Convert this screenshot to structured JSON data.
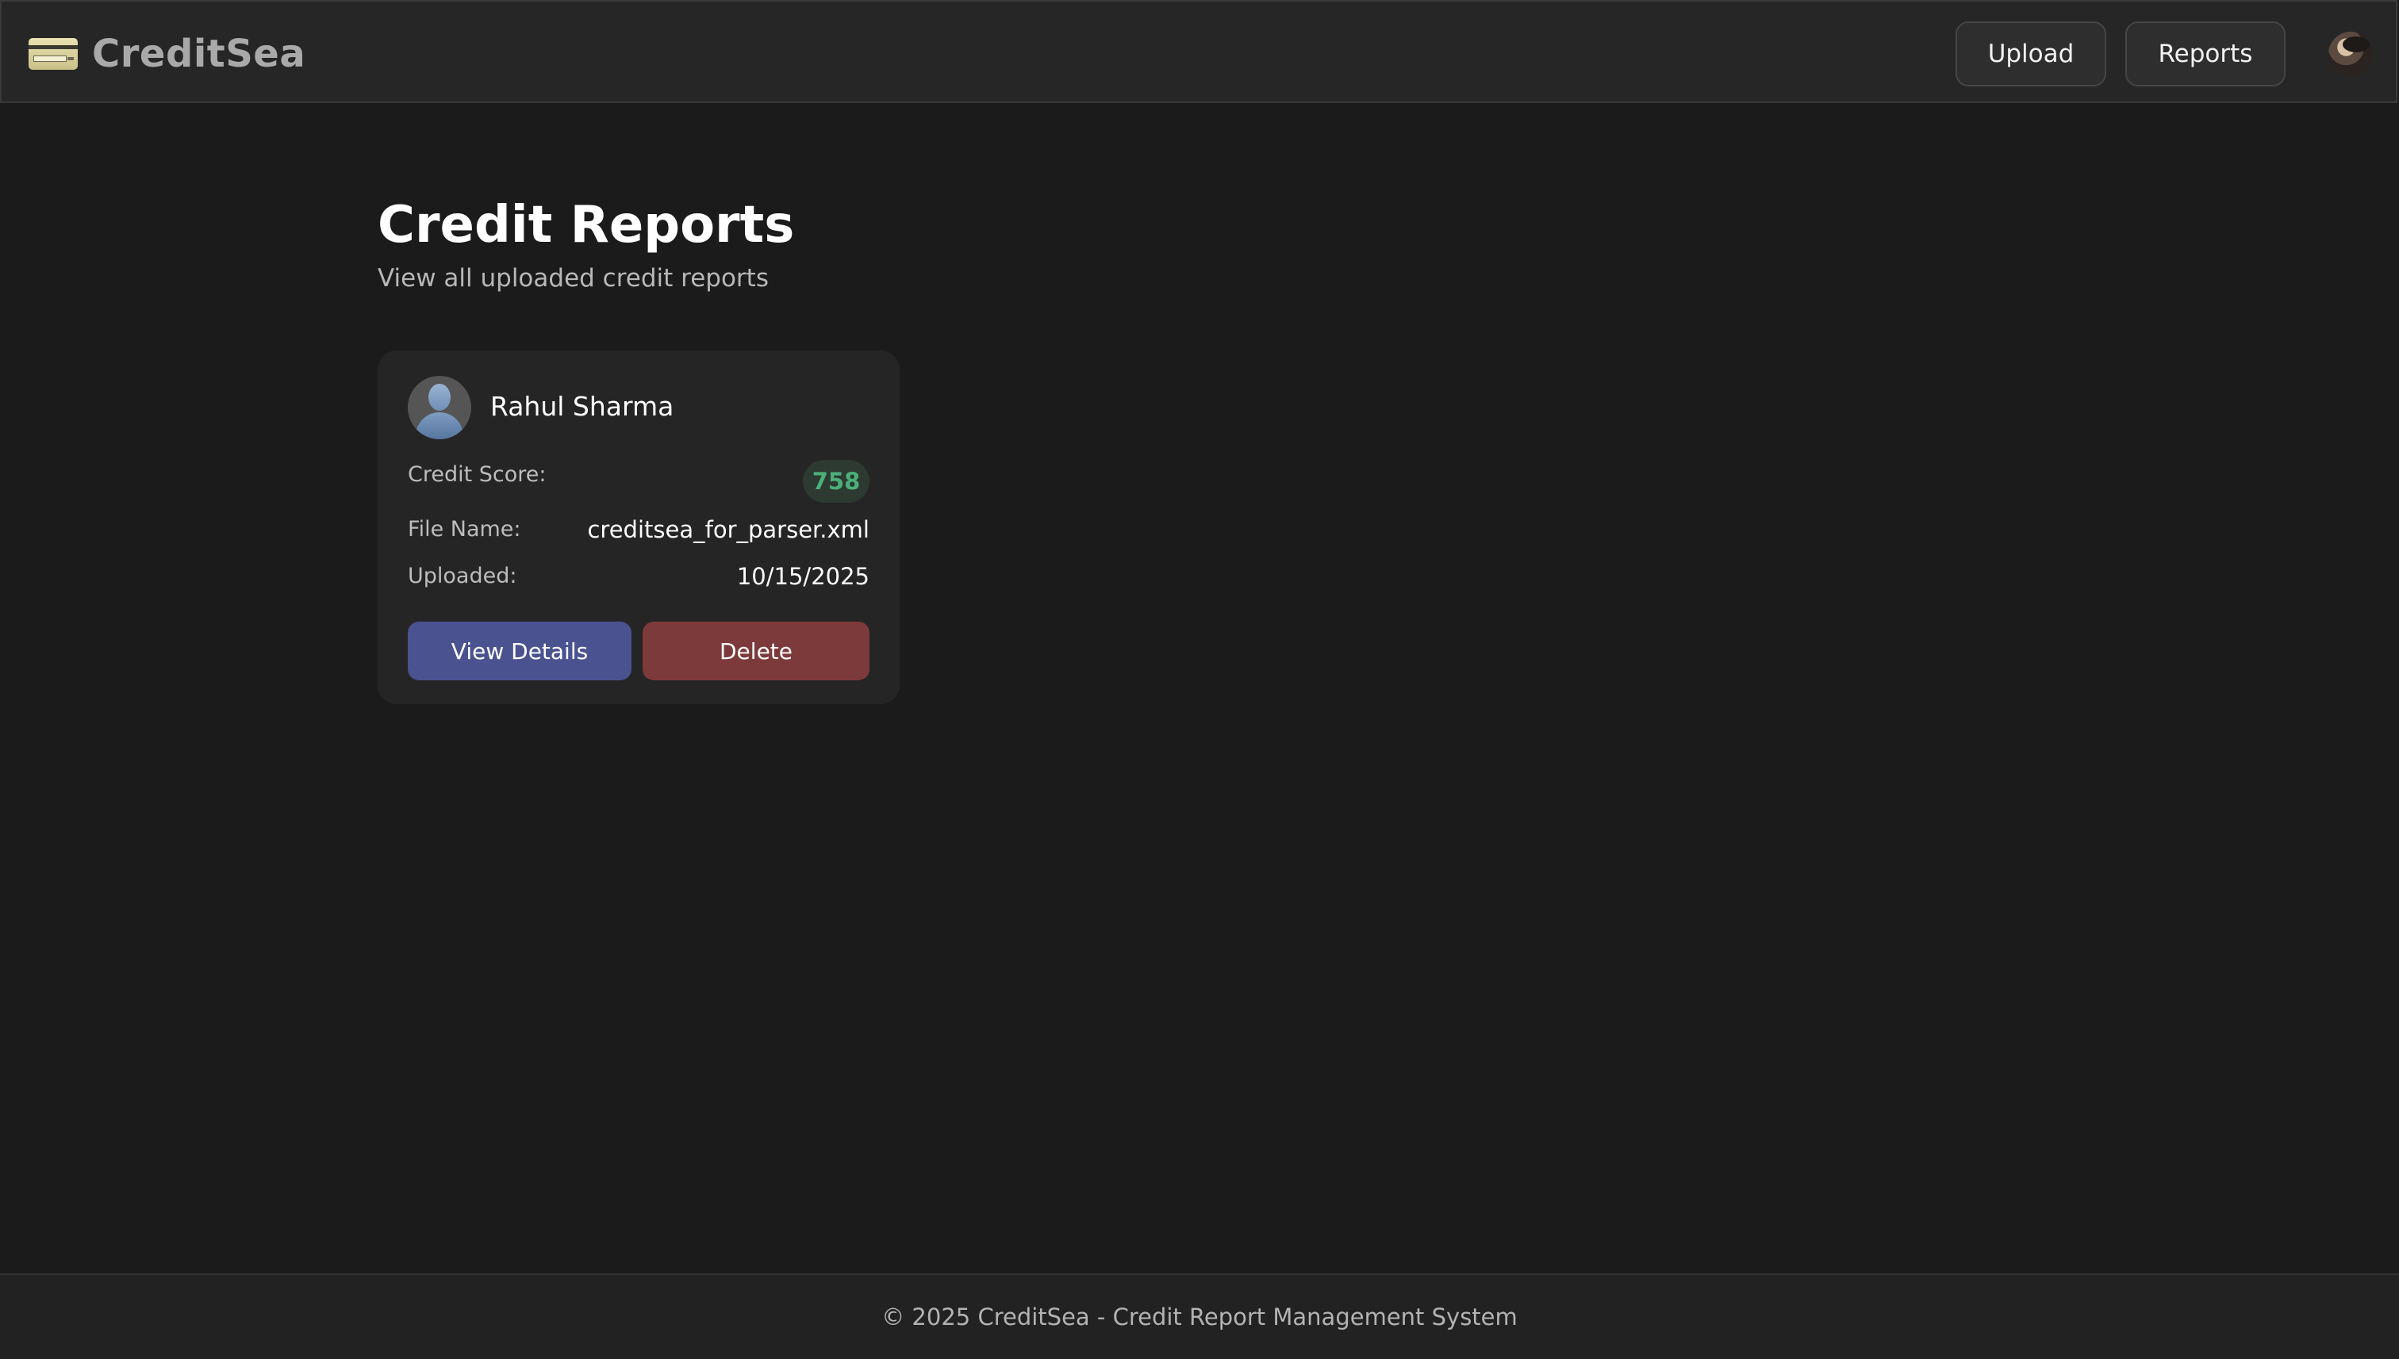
{
  "app": {
    "name": "CreditSea"
  },
  "nav": {
    "upload_label": "Upload",
    "reports_label": "Reports"
  },
  "page": {
    "title": "Credit Reports",
    "subtitle": "View all uploaded credit reports"
  },
  "reports": [
    {
      "name": "Rahul Sharma",
      "credit_score_label": "Credit Score:",
      "credit_score": "758",
      "file_name_label": "File Name:",
      "file_name": "creditsea_for_parser.xml",
      "uploaded_label": "Uploaded:",
      "uploaded": "10/15/2025",
      "view_label": "View Details",
      "delete_label": "Delete"
    }
  ],
  "footer": {
    "text": "© 2025 CreditSea - Credit Report Management System"
  },
  "colors": {
    "background": "#1b1b1b",
    "score_good": "#4caf7a",
    "view_button": "#4a5290",
    "delete_button": "#7d3a3a"
  },
  "icons": {
    "logo": "credit-card-icon",
    "profile": "user-avatar",
    "report_avatar": "person-silhouette-icon"
  }
}
